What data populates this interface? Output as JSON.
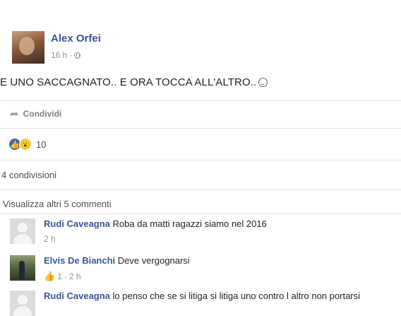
{
  "post": {
    "author": "Alex Orfei",
    "time": "16 h",
    "separator": "·",
    "text": "E UNO SACCAGNATO.. E ORA TOCCA ALL'ALTRO..",
    "share_label": "Condividi",
    "reaction_count": "10",
    "shares": "4 condivisioni",
    "more_comments": "Visualizza altri 5 commenti",
    "icons": {
      "privacy": "globe-icon",
      "emoji": "smile-icon",
      "share": "share-arrow-icon",
      "reactions": [
        "like-icon",
        "wow-icon"
      ]
    }
  },
  "comments": [
    {
      "author": "Rudi Caveagna",
      "text": "Roba da matti ragazzi siamo nel 2016",
      "meta": "2 h"
    },
    {
      "author": "Elvis De Bianchi",
      "text": "Deve vergognarsi",
      "likes": "1",
      "separator": "·",
      "time": "2 h"
    },
    {
      "author": "Rudi Caveagna",
      "text": "lo penso che se si litiga si litiga uno contro l altro non portarsi"
    }
  ],
  "colors": {
    "link": "#365899",
    "meta": "#90949c",
    "like": "#4267b2",
    "wow": "#f7c948"
  }
}
